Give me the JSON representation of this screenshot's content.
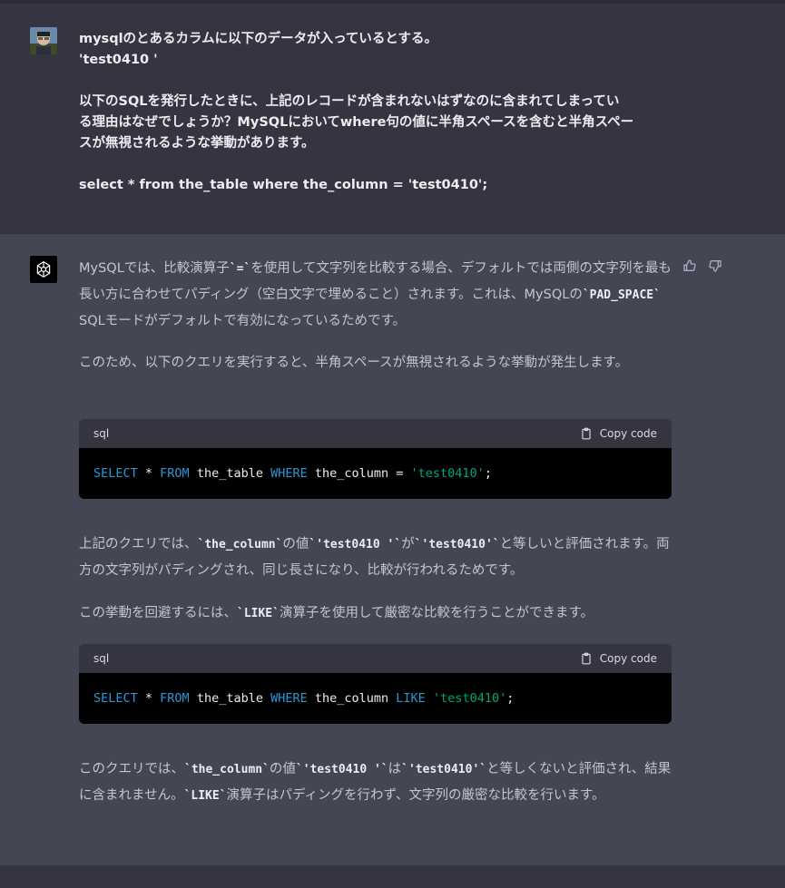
{
  "user_message": {
    "lines": [
      "mysqlのとあるカラムに以下のデータが入っているとする。",
      "'test0410 '",
      "",
      "以下のSQLを発行したときに、上記のレコードが含まれないはずなのに含まれてしまってい",
      "る理由はなぜでしょうか？MySQLにおいてwhere句の値に半角スペースを含むと半角スペー",
      "スが無視されるような挙動があります。",
      "",
      "select * from the_table where the_column = 'test0410';"
    ]
  },
  "assistant": {
    "p1": {
      "a": "MySQLでは、比較演算子",
      "code1": "`=`",
      "b": "を使用して文字列を比較する場合、デフォルトでは両側の文字列を最も長い方に合わせてパディング（空白文字で埋めること）されます。これは、MySQLの",
      "code2": "`PAD_SPACE`",
      "c": " SQLモードがデフォルトで有効になっているためです。"
    },
    "p2": "このため、以下のクエリを実行すると、半角スペースが無視されるような挙動が発生します。",
    "code_block_1": {
      "lang": "sql",
      "copy_label": "Copy code",
      "t1": "SELECT",
      "t2": " * ",
      "t3": "FROM",
      "t4": " the_table ",
      "t5": "WHERE",
      "t6": " the_column = ",
      "t7": "'test0410'",
      "t8": ";"
    },
    "p3": {
      "a": "上記のクエリでは、",
      "code1": "`the_column`",
      "b": "の値",
      "code2": "`'test0410 '`",
      "c": "が",
      "code3": "`'test0410'`",
      "d": "と等しいと評価されます。両方の文字列がパディングされ、同じ長さになり、比較が行われるためです。"
    },
    "p4": {
      "a": "この挙動を回避するには、",
      "code1": "`LIKE`",
      "b": "演算子を使用して厳密な比較を行うことができます。"
    },
    "code_block_2": {
      "lang": "sql",
      "copy_label": "Copy code",
      "t1": "SELECT",
      "t2": " * ",
      "t3": "FROM",
      "t4": " the_table ",
      "t5": "WHERE",
      "t6": " the_column ",
      "t7": "LIKE",
      "t8": " ",
      "t9": "'test0410'",
      "t10": ";"
    },
    "p5": {
      "a": "このクエリでは、",
      "code1": "`the_column`",
      "b": "の値",
      "code2": "`'test0410 '`",
      "c": "は",
      "code3": "`'test0410'`",
      "d": "と等しくないと評価され、結果に含まれません。",
      "code4": "`LIKE`",
      "e": "演算子はパディングを行わず、文字列の厳密な比較を行います。"
    }
  },
  "colors": {
    "user_bg": "#343541",
    "assistant_bg": "#444654",
    "keyword": "#2e95d3",
    "string": "#00a67d"
  },
  "icons": [
    "user-avatar",
    "chatgpt-logo-icon",
    "clipboard-icon",
    "thumbs-up-icon",
    "thumbs-down-icon"
  ]
}
